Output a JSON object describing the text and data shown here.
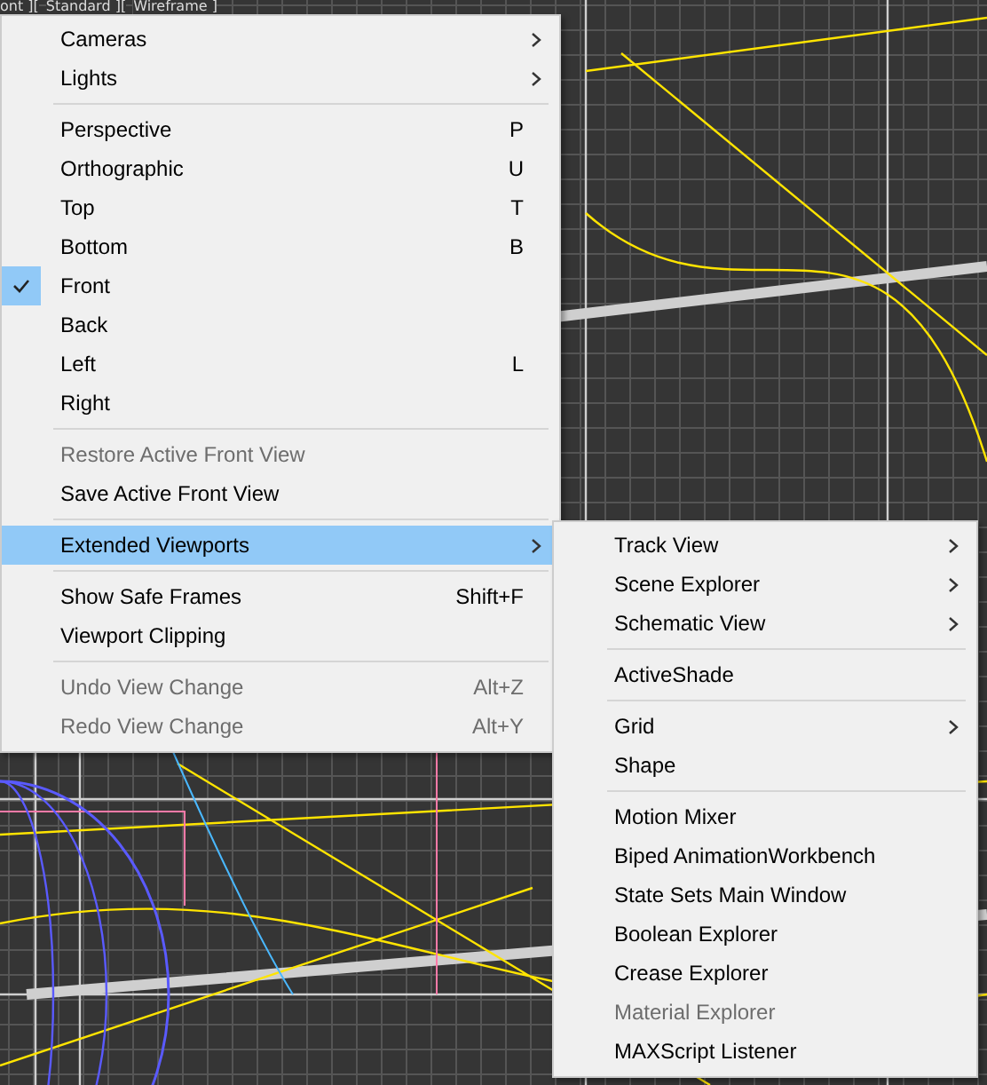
{
  "viewport": {
    "labels": [
      "ont ][",
      "Standard ][",
      "Wireframe ]"
    ]
  },
  "menu": {
    "items": [
      {
        "kind": "item",
        "label": "Cameras",
        "submenu": true,
        "checked": false,
        "disabled": false,
        "selected": false
      },
      {
        "kind": "item",
        "label": "Lights",
        "submenu": true,
        "checked": false,
        "disabled": false,
        "selected": false
      },
      {
        "kind": "separator"
      },
      {
        "kind": "item",
        "label": "Perspective",
        "shortcut": "P",
        "submenu": false,
        "checked": false,
        "disabled": false,
        "selected": false
      },
      {
        "kind": "item",
        "label": "Orthographic",
        "shortcut": "U",
        "submenu": false,
        "checked": false,
        "disabled": false,
        "selected": false
      },
      {
        "kind": "item",
        "label": "Top",
        "shortcut": "T",
        "submenu": false,
        "checked": false,
        "disabled": false,
        "selected": false
      },
      {
        "kind": "item",
        "label": "Bottom",
        "shortcut": "B",
        "submenu": false,
        "checked": false,
        "disabled": false,
        "selected": false
      },
      {
        "kind": "item",
        "label": "Front",
        "submenu": false,
        "checked": true,
        "disabled": false,
        "selected": false
      },
      {
        "kind": "item",
        "label": "Back",
        "submenu": false,
        "checked": false,
        "disabled": false,
        "selected": false
      },
      {
        "kind": "item",
        "label": "Left",
        "shortcut": "L",
        "submenu": false,
        "checked": false,
        "disabled": false,
        "selected": false
      },
      {
        "kind": "item",
        "label": "Right",
        "submenu": false,
        "checked": false,
        "disabled": false,
        "selected": false
      },
      {
        "kind": "separator"
      },
      {
        "kind": "item",
        "label": "Restore Active Front View",
        "submenu": false,
        "checked": false,
        "disabled": true,
        "selected": false
      },
      {
        "kind": "item",
        "label": "Save Active Front View",
        "submenu": false,
        "checked": false,
        "disabled": false,
        "selected": false
      },
      {
        "kind": "separator"
      },
      {
        "kind": "item",
        "label": "Extended Viewports",
        "submenu": true,
        "checked": false,
        "disabled": false,
        "selected": true
      },
      {
        "kind": "separator"
      },
      {
        "kind": "item",
        "label": "Show Safe Frames",
        "shortcut": "Shift+F",
        "submenu": false,
        "checked": false,
        "disabled": false,
        "selected": false
      },
      {
        "kind": "item",
        "label": "Viewport Clipping",
        "submenu": false,
        "checked": false,
        "disabled": false,
        "selected": false
      },
      {
        "kind": "separator"
      },
      {
        "kind": "item",
        "label": "Undo View Change",
        "shortcut": "Alt+Z",
        "submenu": false,
        "checked": false,
        "disabled": true,
        "selected": false
      },
      {
        "kind": "item",
        "label": "Redo View Change",
        "shortcut": "Alt+Y",
        "submenu": false,
        "checked": false,
        "disabled": true,
        "selected": false
      }
    ]
  },
  "submenu": {
    "items": [
      {
        "kind": "item",
        "label": "Track View",
        "submenu": true,
        "disabled": false
      },
      {
        "kind": "item",
        "label": "Scene Explorer",
        "submenu": true,
        "disabled": false
      },
      {
        "kind": "item",
        "label": "Schematic View",
        "submenu": true,
        "disabled": false
      },
      {
        "kind": "separator"
      },
      {
        "kind": "item",
        "label": "ActiveShade",
        "submenu": false,
        "disabled": false
      },
      {
        "kind": "separator"
      },
      {
        "kind": "item",
        "label": "Grid",
        "submenu": true,
        "disabled": false
      },
      {
        "kind": "item",
        "label": "Shape",
        "submenu": false,
        "disabled": false
      },
      {
        "kind": "separator"
      },
      {
        "kind": "item",
        "label": "Motion Mixer",
        "submenu": false,
        "disabled": false
      },
      {
        "kind": "item",
        "label": "Biped AnimationWorkbench",
        "submenu": false,
        "disabled": false
      },
      {
        "kind": "item",
        "label": "State Sets Main Window",
        "submenu": false,
        "disabled": false
      },
      {
        "kind": "item",
        "label": "Boolean Explorer",
        "submenu": false,
        "disabled": false
      },
      {
        "kind": "item",
        "label": "Crease Explorer",
        "submenu": false,
        "disabled": false
      },
      {
        "kind": "item",
        "label": "Material Explorer",
        "submenu": false,
        "disabled": true
      },
      {
        "kind": "item",
        "label": "MAXScript Listener",
        "submenu": false,
        "disabled": false
      }
    ]
  }
}
